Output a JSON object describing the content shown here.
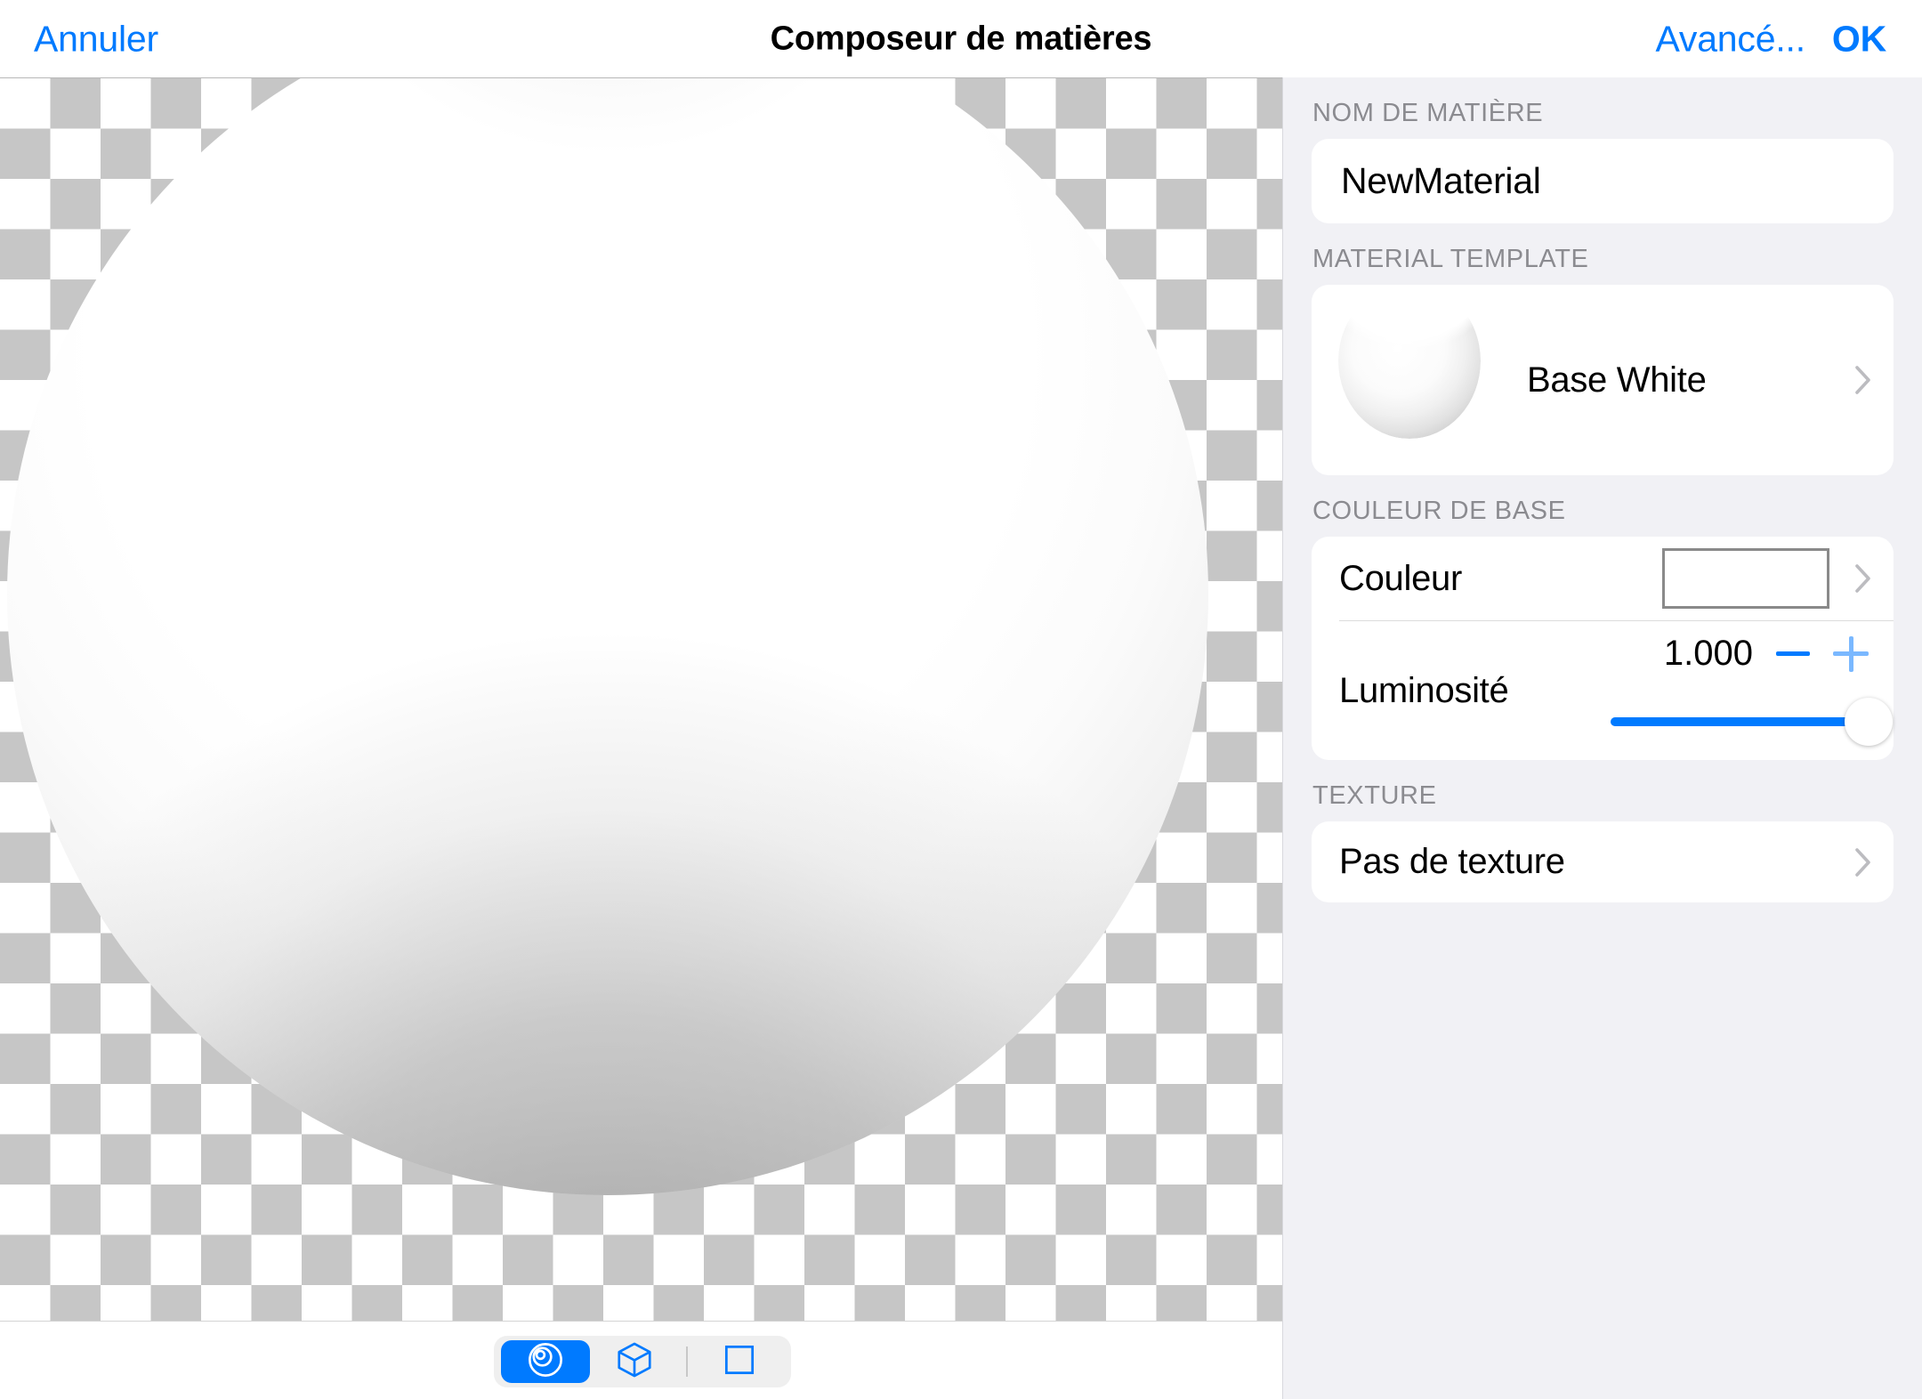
{
  "navbar": {
    "cancel_label": "Annuler",
    "title": "Composeur de matières",
    "advanced_label": "Avancé...",
    "ok_label": "OK"
  },
  "panel": {
    "sections": {
      "name": {
        "header": "NOM DE MATIÈRE",
        "value": "NewMaterial"
      },
      "template": {
        "header": "MATERIAL TEMPLATE",
        "value": "Base White"
      },
      "base_color": {
        "header": "COULEUR DE BASE",
        "color_label": "Couleur",
        "color_value": "#FFFFFF",
        "brightness_label": "Luminosité",
        "brightness_value": "1.000",
        "brightness_min": "0.000",
        "brightness_max": "1.000",
        "brightness_percent": 100,
        "minus_label": "−",
        "plus_label": "+"
      },
      "texture": {
        "header": "TEXTURE",
        "value": "Pas de texture"
      }
    }
  },
  "canvas": {
    "preview_shape": "sphere",
    "background": "transparency-checkerboard"
  },
  "bottom_toolbar": {
    "items": [
      {
        "icon": "sphere-icon",
        "selected": true
      },
      {
        "icon": "cube-icon",
        "selected": false
      },
      {
        "icon": "square-icon",
        "selected": false
      }
    ]
  },
  "colors": {
    "accent": "#007AFF",
    "accent_light": "#7AB8FF",
    "panel_bg": "#F1F1F5",
    "card_bg": "#FFFFFF",
    "section_header_text": "#8B8B90",
    "checker_gray": "#C6C6C6"
  }
}
